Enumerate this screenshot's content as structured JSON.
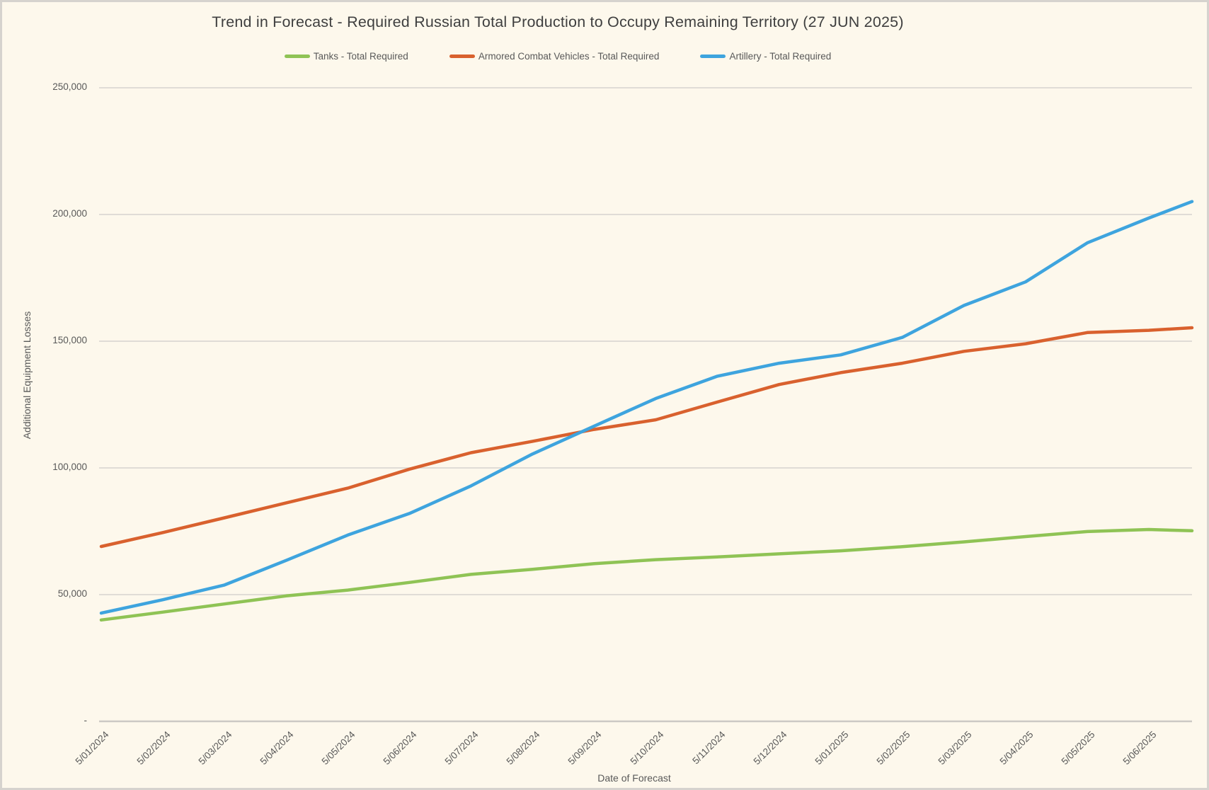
{
  "page": {
    "background_color": "#FDF8EC",
    "border_color": "#D6D3CE",
    "text_color": "#595959",
    "title_color": "#3F3F3F",
    "gridline_color": "#DBD8D3",
    "axisline_color": "#CCC9C4"
  },
  "chart_data": {
    "type": "line",
    "title": "Trend in Forecast - Required Russian Total Production to Occupy Remaining Territory (27 JUN 2025)",
    "xlabel": "Date of Forecast",
    "ylabel": "Additional Equipment Losses",
    "ylim": [
      0,
      250000
    ],
    "ytick_interval": 50000,
    "ytick_labels": [
      "250,000",
      "200,000",
      "150,000",
      "100,000",
      "50,000",
      "-"
    ],
    "ytick_values": [
      250000,
      200000,
      150000,
      100000,
      50000,
      0
    ],
    "grid": true,
    "legend_position": "top",
    "x_tick_labels": [
      "5/01/2024",
      "5/02/2024",
      "5/03/2024",
      "5/04/2024",
      "5/05/2024",
      "5/06/2024",
      "5/07/2024",
      "5/08/2024",
      "5/09/2024",
      "5/10/2024",
      "5/11/2024",
      "5/12/2024",
      "5/01/2025",
      "5/02/2025",
      "5/03/2025",
      "5/04/2025",
      "5/05/2025",
      "5/06/2025"
    ],
    "categories": [
      "5/01/2024",
      "5/02/2024",
      "5/03/2024",
      "5/04/2024",
      "5/05/2024",
      "5/06/2024",
      "5/07/2024",
      "5/08/2024",
      "5/09/2024",
      "5/10/2024",
      "5/11/2024",
      "5/12/2024",
      "5/01/2025",
      "5/02/2025",
      "5/03/2025",
      "5/04/2025",
      "5/05/2025",
      "5/06/2025",
      "27/06/2025"
    ],
    "x_month_offsets": [
      0,
      1,
      2,
      3,
      4,
      5,
      6,
      7,
      8,
      9,
      10,
      11,
      12,
      13,
      14,
      15,
      16,
      17,
      17.7
    ],
    "series": [
      {
        "name": "Tanks - Total Required",
        "color": "#8FC355",
        "values": [
          40000,
          43100,
          46300,
          49500,
          51800,
          54800,
          58000,
          60000,
          62200,
          63800,
          64900,
          66100,
          67300,
          68900,
          70800,
          72900,
          74900,
          75700,
          75200
        ]
      },
      {
        "name": "Armored Combat Vehicles - Total Required",
        "color": "#D9612E",
        "values": [
          69000,
          74500,
          80300,
          86200,
          92000,
          99500,
          106000,
          110500,
          115200,
          119000,
          126000,
          132900,
          137600,
          141300,
          146000,
          149000,
          153400,
          154300,
          155300
        ]
      },
      {
        "name": "Artillery - Total Required",
        "color": "#3EA4DE",
        "values": [
          42700,
          48000,
          53800,
          63500,
          73500,
          82000,
          92900,
          105500,
          116500,
          127400,
          136200,
          141300,
          144600,
          151500,
          164100,
          173400,
          188800,
          198600,
          205100
        ]
      }
    ]
  }
}
